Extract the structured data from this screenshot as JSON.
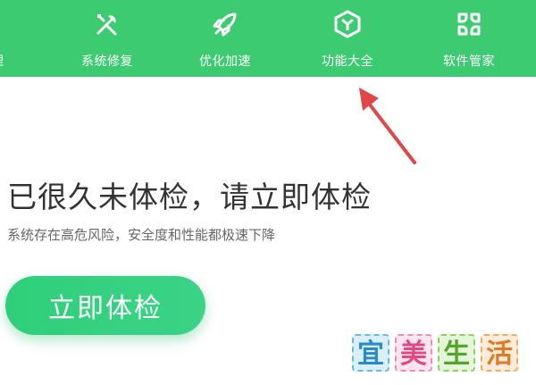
{
  "toolbar": {
    "background": "#3dcb72",
    "items": [
      {
        "label": "理",
        "icon": "broom-icon"
      },
      {
        "label": "系统修复",
        "icon": "wrench-screwdriver-icon"
      },
      {
        "label": "优化加速",
        "icon": "rocket-icon"
      },
      {
        "label": "功能大全",
        "icon": "cube-icon"
      },
      {
        "label": "软件管家",
        "icon": "grid-flower-icon"
      }
    ]
  },
  "annotation": {
    "arrow_color": "#e04848"
  },
  "main": {
    "headline": "已很久未体检，请立即体检",
    "subline": "系统存在高危风险，安全度和性能都极速下降",
    "check_button_label": "立即体检",
    "accent": "#2fcf7a"
  },
  "watermark": {
    "chars": [
      "宜",
      "美",
      "生",
      "活"
    ]
  }
}
